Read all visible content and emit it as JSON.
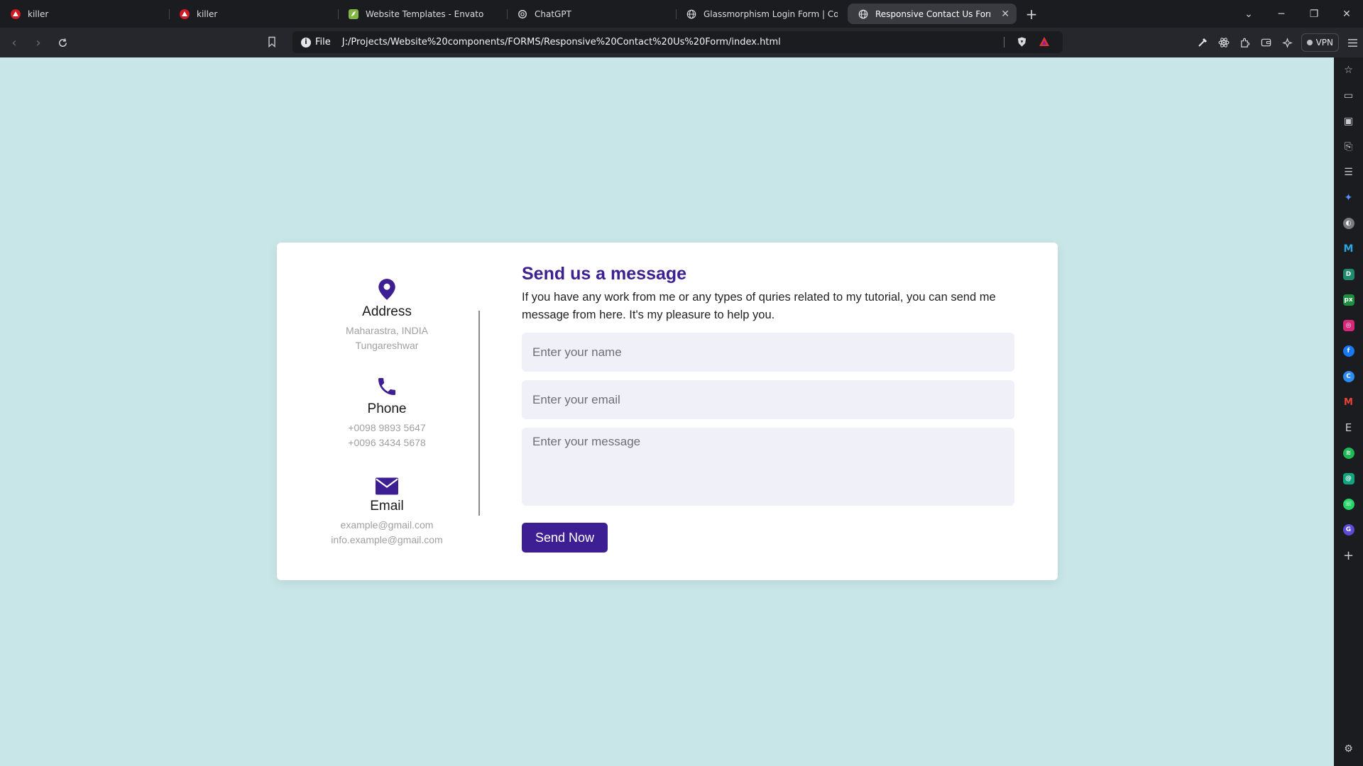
{
  "browser": {
    "tabs": [
      {
        "title": "killer",
        "icon": "red-logo-icon"
      },
      {
        "title": "killer",
        "icon": "red-logo-icon"
      },
      {
        "title": "Website Templates - Envato",
        "icon": "envato-icon"
      },
      {
        "title": "ChatGPT",
        "icon": "chatgpt-icon"
      },
      {
        "title": "Glassmorphism Login Form | Coding",
        "icon": "globe-icon"
      },
      {
        "title": "Responsive Contact Us Form",
        "icon": "globe-icon",
        "active": true
      }
    ],
    "address": {
      "scheme_label": "File",
      "url": "J:/Projects/Website%20components/FORMS/Responsive%20Contact%20Us%20Form/index.html"
    },
    "vpn_label": "VPN"
  },
  "contact": {
    "address": {
      "title": "Address",
      "line1": "Maharastra, INDIA",
      "line2": "Tungareshwar"
    },
    "phone": {
      "title": "Phone",
      "line1": "+0098 9893 5647",
      "line2": "+0096 3434 5678"
    },
    "email": {
      "title": "Email",
      "line1": "example@gmail.com",
      "line2": "info.example@gmail.com"
    }
  },
  "form": {
    "heading": "Send us a message",
    "description": "If you have any work from me or any types of quries related to my tutorial, you can send me message from here. It's my pleasure to help you.",
    "name_placeholder": "Enter your name",
    "email_placeholder": "Enter your email",
    "message_placeholder": "Enter your message",
    "submit_label": "Send Now"
  },
  "colors": {
    "page_bg": "#c8e6e8",
    "accent": "#3e1f93",
    "field_bg": "#f0f1f8"
  }
}
